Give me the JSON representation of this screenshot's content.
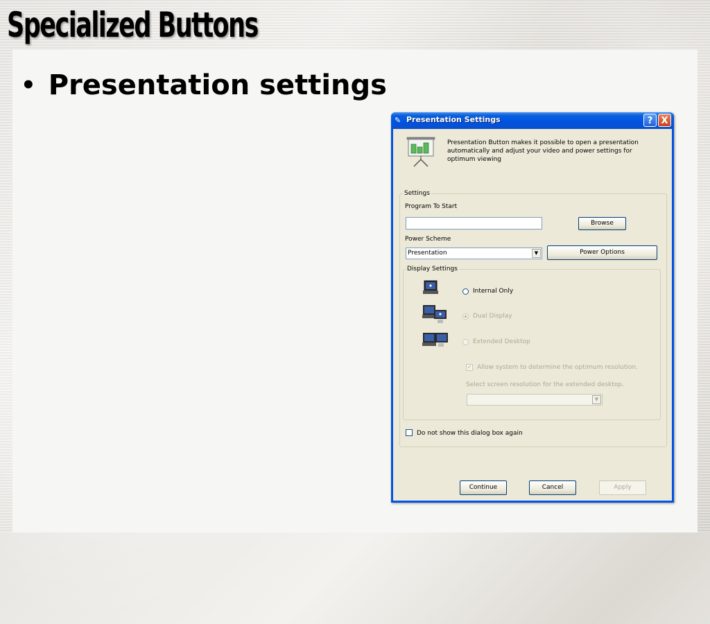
{
  "slide": {
    "title": "Specialized Buttons",
    "bullet": "Presentation settings"
  },
  "dialog": {
    "title": "Presentation Settings",
    "help_button": "?",
    "close_button": "X",
    "description": "Presentation Button makes it possible to open a presentation automatically and adjust your video and power settings for optimum viewing",
    "settings_group": "Settings",
    "program_label": "Program To Start",
    "program_value": "",
    "browse_button": "Browse",
    "power_scheme_label": "Power Scheme",
    "power_scheme_value": "Presentation",
    "power_options_button": "Power Options",
    "display_group": "Display Settings",
    "radio_internal": "Internal Only",
    "radio_dual": "Dual Display",
    "radio_extended": "Extended Desktop",
    "allow_system_label": "Allow system to determine the optimum resolution.",
    "select_resolution_label": "Select screen resolution for the extended desktop.",
    "resolution_value": "",
    "dont_show_label": "Do not show this dialog box again",
    "continue_button": "Continue",
    "cancel_button": "Cancel",
    "apply_button": "Apply"
  },
  "colors": {
    "titlebar": "#0054e3",
    "client": "#ece9d8",
    "disabled_text": "#aca899"
  }
}
